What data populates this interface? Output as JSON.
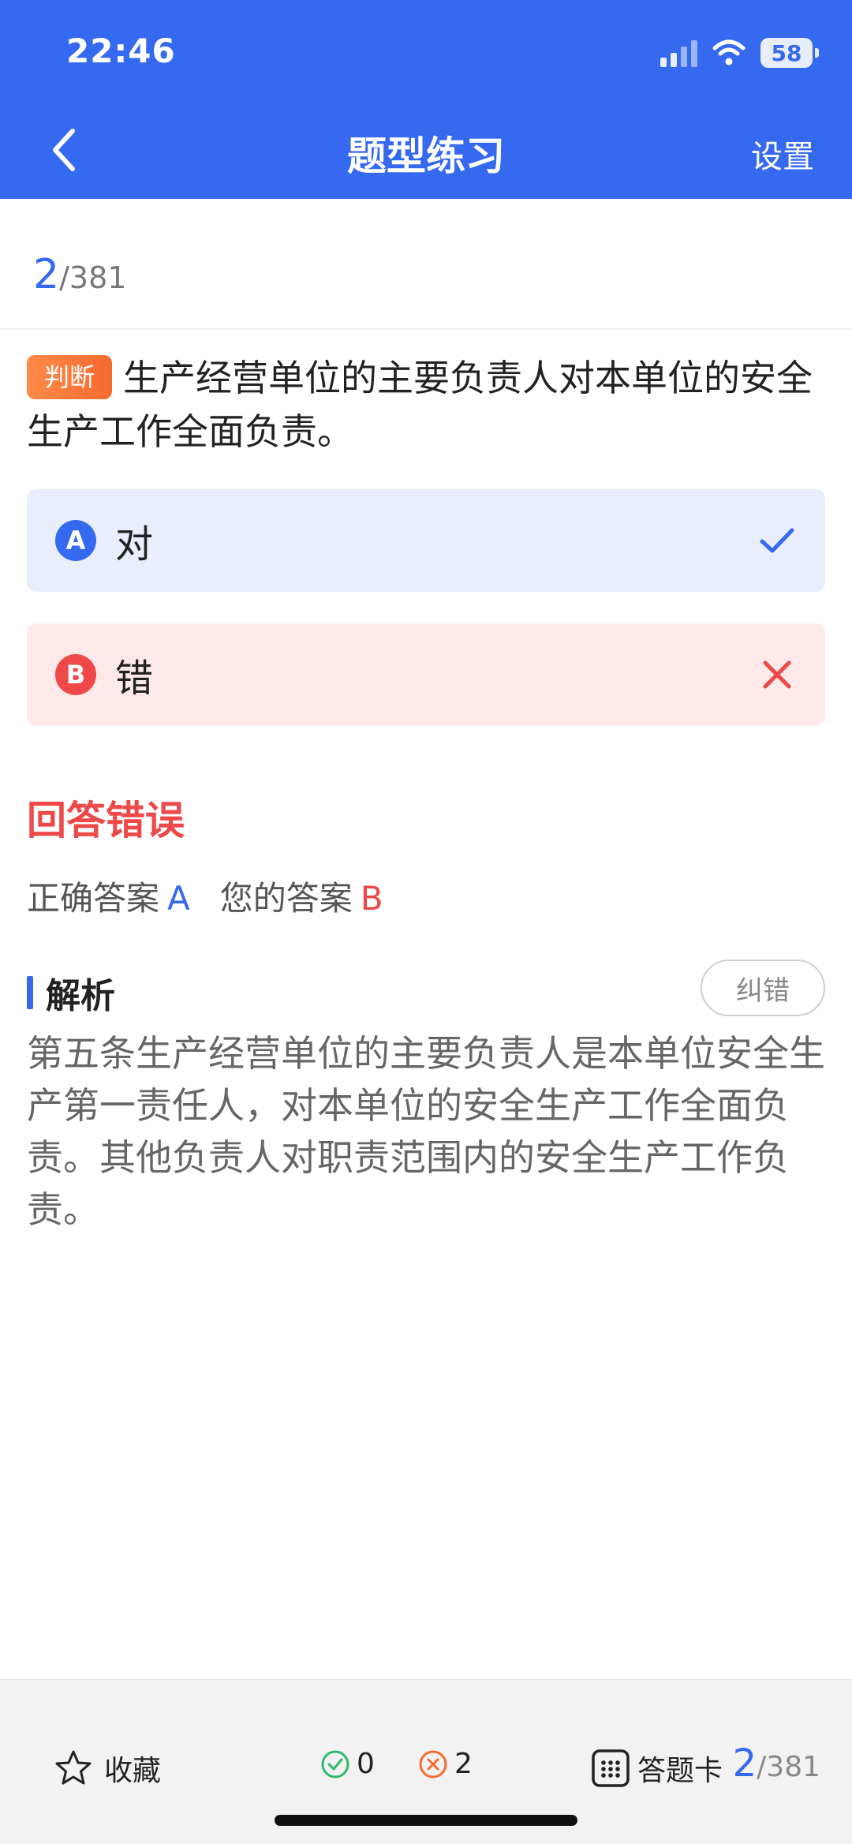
{
  "status_bar": {
    "time": "22:46",
    "battery": "58"
  },
  "header": {
    "title": "题型练习",
    "settings_label": "设置"
  },
  "progress": {
    "current": "2",
    "total": "/381"
  },
  "question": {
    "type_label": "判断",
    "text": "生产经营单位的主要负责人对本单位的安全生产工作全面负责。"
  },
  "options": [
    {
      "letter": "A",
      "text": "对",
      "state": "correct"
    },
    {
      "letter": "B",
      "text": "错",
      "state": "wrong"
    }
  ],
  "result": {
    "label": "回答错误",
    "correct_answer_label": "正确答案",
    "correct_answer": "A",
    "your_answer_label": "您的答案",
    "your_answer": "B"
  },
  "analysis": {
    "title": "解析",
    "report_label": "纠错",
    "text": "第五条生产经营单位的主要负责人是本单位安全生产第一责任人，对本单位的安全生产工作全面负责。其他负责人对职责范围内的安全生产工作负责。"
  },
  "bottom_bar": {
    "favorite_label": "收藏",
    "correct_count": "0",
    "wrong_count": "2",
    "answer_card_label": "答题卡",
    "current": "2",
    "total": "/381"
  },
  "colors": {
    "primary": "#3569f0",
    "error": "#ef4848",
    "success": "#2fb86b",
    "tag": "#f56a2f"
  },
  "icons": [
    "back-icon",
    "wifi-icon",
    "signal-icon",
    "battery-icon",
    "check-icon",
    "close-icon",
    "star-icon",
    "check-circle-icon",
    "x-circle-icon",
    "grid-icon"
  ]
}
